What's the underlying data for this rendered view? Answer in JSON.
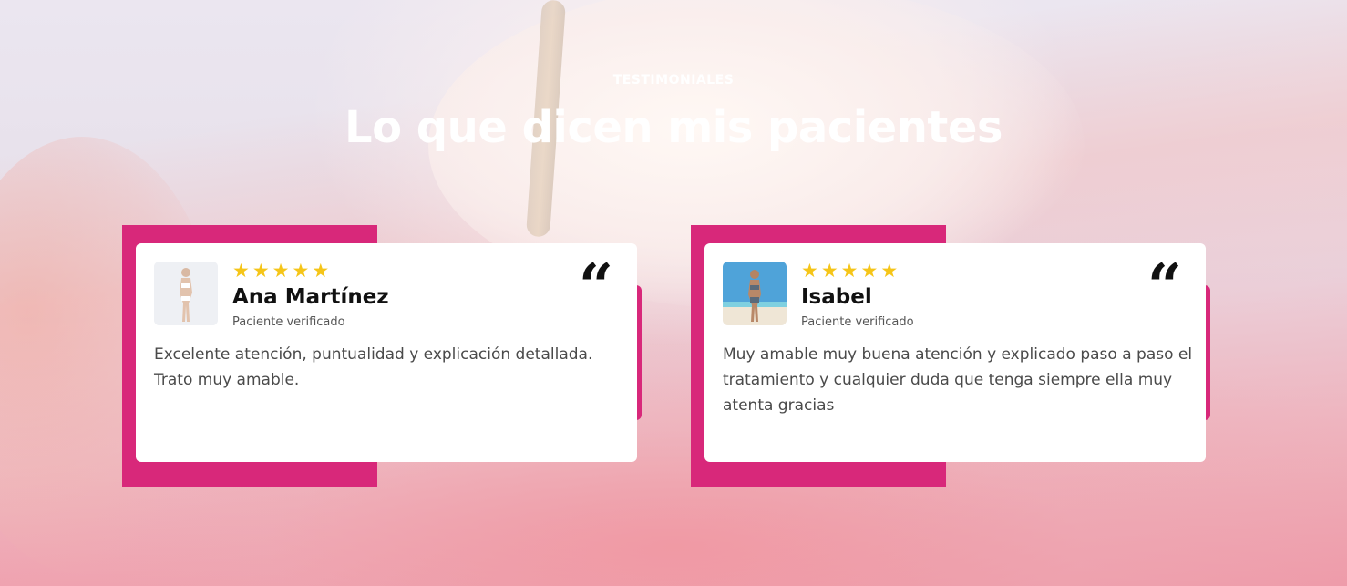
{
  "section": {
    "tag": "TESTIMONIALES",
    "title": "Lo que dicen mis pacientes"
  },
  "colors": {
    "accent": "#d8287a",
    "star": "#f5c518"
  },
  "testimonials": [
    {
      "name": "Ana Martínez",
      "role": "Paciente verificado",
      "rating": 5,
      "text": "Excelente atención, puntualidad y explicación detallada. Trato muy amable.",
      "avatar_icon": "avatar-photo"
    },
    {
      "name": "Isabel",
      "role": "Paciente verificado",
      "rating": 5,
      "text": "Muy amable muy buena atención y explicado paso a paso el tratamiento y cualquier duda que tenga siempre ella muy atenta gracias",
      "avatar_icon": "avatar-photo"
    }
  ],
  "icons": {
    "star": "star-icon",
    "quote": "quote-icon"
  }
}
